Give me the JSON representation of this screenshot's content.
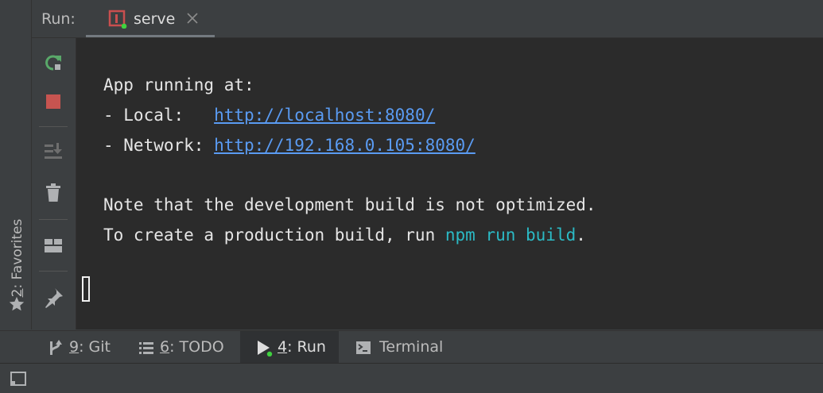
{
  "favorites": {
    "number": "2",
    "label": ": Favorites",
    "icon": "star-icon"
  },
  "run_panel": {
    "title": "Run:",
    "tab": {
      "label": "serve",
      "icon": "npm-serve-icon",
      "status_color": "#59a869"
    }
  },
  "toolbar": {
    "buttons": [
      {
        "name": "rerun",
        "icon": "rerun-icon",
        "color": "#59a869"
      },
      {
        "name": "stop",
        "icon": "stop-icon",
        "color": "#c75450"
      },
      {
        "name": "scroll-to-end",
        "icon": "scroll-to-end-icon"
      },
      {
        "name": "clear-all",
        "icon": "trash-icon"
      },
      {
        "name": "restore-layout",
        "icon": "layout-icon"
      },
      {
        "name": "pin-tab",
        "icon": "pin-icon"
      }
    ]
  },
  "console": {
    "line1": "App running at:",
    "local_prefix": "- Local:   ",
    "local_url": "http://localhost:8080/",
    "network_prefix": "- Network: ",
    "network_url": "http://192.168.0.105:8080/",
    "note_line": "Note that the development build is not optimized.",
    "build_prefix": "To create a production build, run ",
    "build_cmd": "npm run build",
    "build_suffix": ".",
    "link_color": "#5a9bf2",
    "cmd_color": "#2bbac5"
  },
  "tool_tabs": {
    "git": {
      "number": "9",
      "label": ": Git",
      "icon": "git-branch-icon"
    },
    "todo": {
      "number": "6",
      "label": ": TODO",
      "icon": "todo-list-icon"
    },
    "run": {
      "number": "4",
      "label": ": Run",
      "icon": "run-play-icon",
      "active": true
    },
    "terminal": {
      "label": "Terminal",
      "icon": "terminal-icon"
    }
  },
  "status_bar": {
    "icon": "tool-windows-toggle-icon"
  }
}
